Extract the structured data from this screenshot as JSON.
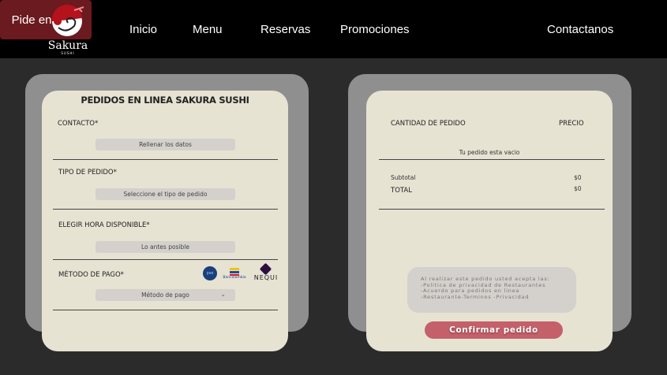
{
  "header": {
    "logo_text": "Sakura",
    "logo_sub": "SUSHI",
    "nav": [
      "Inicio",
      "Menu",
      "Reservas",
      "Promociones",
      "Pide en linea",
      "Contactanos"
    ],
    "active_color": "#6b1a1f"
  },
  "order_form": {
    "title": "PEDIDOS EN LINEA SAKURA SUSHI",
    "contact_label": "CONTACTO*",
    "contact_placeholder": "Rellenar los datos",
    "type_label": "TIPO DE PEDIDO*",
    "type_placeholder": "Seleccione el tipo de pedido",
    "time_label": "ELEGIR HORA DISPONIBLE*",
    "time_value": "Lo antes posible",
    "payment_label": "MÉTODO DE PAGO*",
    "payment_placeholder": "Método de pago",
    "payment_logos": [
      "pse",
      "Bancolombia",
      "NEQUI"
    ]
  },
  "summary": {
    "qty_header": "CANTIDAD DE PEDIDO",
    "price_header": "PRECIO",
    "empty": "Tu pedido esta vacio",
    "subtotal_label": "Subtotal",
    "subtotal": "$0",
    "total_label": "TOTAL",
    "total": "$0",
    "terms": [
      "Al realizar este pedido usted acepta las:",
      "-Politica de privacidad de Restaurantes",
      "-Acuerdo para pedidos en linea",
      "-Restaurante-Terminos -Privacidad"
    ],
    "confirm": "Confirmar pedido",
    "confirm_color": "#c4606a"
  }
}
